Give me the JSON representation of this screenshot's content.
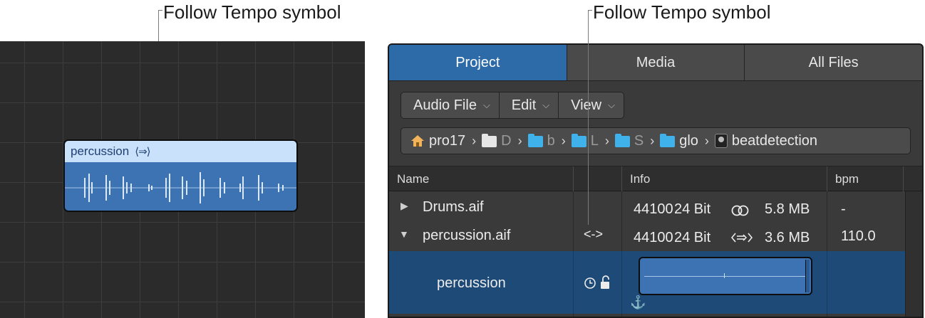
{
  "callouts": {
    "left": "Follow Tempo symbol",
    "right": "Follow Tempo symbol"
  },
  "tracks_region": {
    "name": "percussion",
    "symbol": "⟨⇒⟩"
  },
  "browser": {
    "tabs": [
      {
        "label": "Project",
        "active": true
      },
      {
        "label": "Media",
        "active": false
      },
      {
        "label": "All Files",
        "active": false
      }
    ],
    "toolbar": {
      "audio_file": "Audio File",
      "edit": "Edit",
      "view": "View",
      "chevron": "⌵"
    },
    "path": [
      {
        "icon": "home-icon",
        "label": "pro17"
      },
      {
        "icon": "folder-icon",
        "label": "D"
      },
      {
        "icon": "folder-icon",
        "label": "b"
      },
      {
        "icon": "folder-icon",
        "label": "L"
      },
      {
        "icon": "folder-icon",
        "label": "S"
      },
      {
        "icon": "folder-icon",
        "label": "glo"
      },
      {
        "icon": "disk-icon",
        "label": "beatdetection"
      }
    ],
    "path_separator": "›",
    "columns": {
      "name": "Name",
      "info": "Info",
      "bpm": "bpm"
    },
    "rows": [
      {
        "disclosure": "▶",
        "name": "Drums.aif",
        "symbol": "",
        "rate": "44100",
        "bits": "24 Bit",
        "format_icon": "stereo-icon",
        "size": "5.8 MB",
        "bpm": "-"
      },
      {
        "disclosure": "▼",
        "name": "percussion.aif",
        "symbol": "<->",
        "rate": "44100",
        "bits": "24 Bit",
        "format_icon": "follow-tempo-icon",
        "size": "3.6 MB",
        "bpm": "110.0"
      }
    ],
    "selected_row": {
      "name": "percussion",
      "icons": [
        "clock-icon",
        "unlock-icon"
      ],
      "anchor": "⚓"
    },
    "colors": {
      "active_tab": "#2d6aa8",
      "selected_row": "#1e4a77",
      "region": "#3d72b3",
      "region_header": "#c9e1fb",
      "folder": "#3fb2ec"
    }
  }
}
